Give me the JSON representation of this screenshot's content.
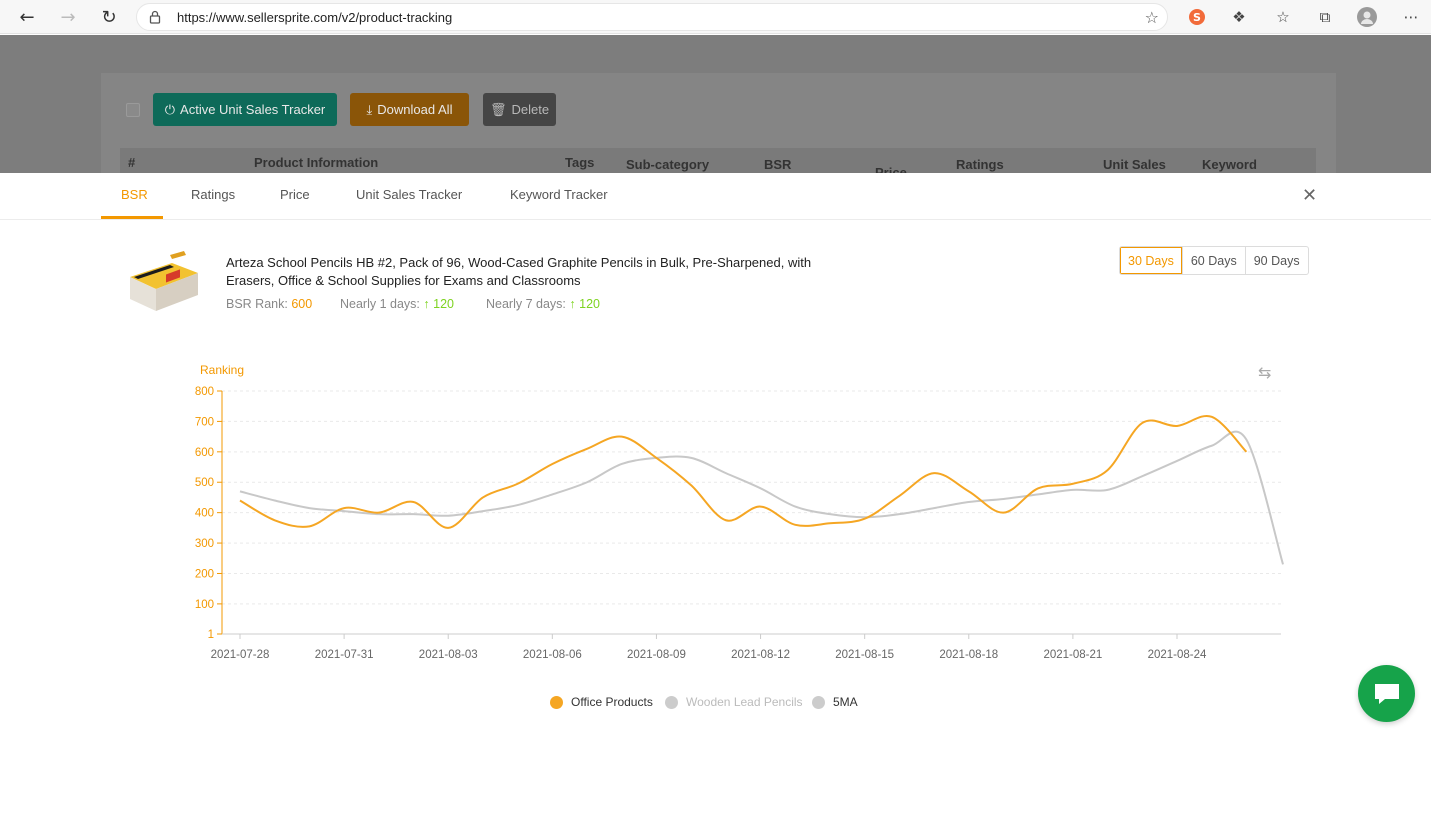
{
  "browser": {
    "url": "https://www.sellersprite.com/v2/product-tracking"
  },
  "toolbar": {
    "active_label": "Active Unit Sales Tracker",
    "download_label": "Download All",
    "delete_label": "Delete"
  },
  "table_headers": [
    "#",
    "Product Information",
    "Tags",
    "Sub-category",
    "BSR",
    "Price",
    "Ratings",
    "Unit Sales",
    "Keyword"
  ],
  "tabs": [
    "BSR",
    "Ratings",
    "Price",
    "Unit Sales Tracker",
    "Keyword Tracker"
  ],
  "active_tab": "BSR",
  "product": {
    "title": "Arteza School Pencils HB #2, Pack of 96, Wood-Cased Graphite Pencils in Bulk, Pre-Sharpened, with Erasers, Office & School Supplies for Exams and Classrooms",
    "bsr_label": "BSR Rank:",
    "bsr_value": "600",
    "n1_label": "Nearly 1 days:",
    "n1_value": "120",
    "n7_label": "Nearly 7 days:",
    "n7_value": "120"
  },
  "day_buttons": [
    "30 Days",
    "60 Days",
    "90 Days"
  ],
  "colors": {
    "accent": "#f39800",
    "series_office": "#f5a623",
    "series_wooden": "#c8c8c8",
    "positive": "#7ed321",
    "chat": "#16a34a"
  },
  "chart_data": {
    "type": "line",
    "ylabel": "Ranking",
    "ylim": [
      1,
      800
    ],
    "yticks": [
      1,
      100,
      200,
      300,
      400,
      500,
      600,
      700,
      800
    ],
    "x_tick_labels": [
      "2021-07-28",
      "2021-07-31",
      "2021-08-03",
      "2021-08-06",
      "2021-08-09",
      "2021-08-12",
      "2021-08-15",
      "2021-08-18",
      "2021-08-21",
      "2021-08-24"
    ],
    "x": [
      "2021-07-28",
      "2021-07-29",
      "2021-07-30",
      "2021-07-31",
      "2021-08-01",
      "2021-08-02",
      "2021-08-03",
      "2021-08-04",
      "2021-08-05",
      "2021-08-06",
      "2021-08-07",
      "2021-08-08",
      "2021-08-09",
      "2021-08-10",
      "2021-08-11",
      "2021-08-12",
      "2021-08-13",
      "2021-08-14",
      "2021-08-15",
      "2021-08-16",
      "2021-08-17",
      "2021-08-18",
      "2021-08-19",
      "2021-08-20",
      "2021-08-21",
      "2021-08-22",
      "2021-08-23",
      "2021-08-24",
      "2021-08-25",
      "2021-08-26",
      "2021-08-27"
    ],
    "series": [
      {
        "name": "Office Products",
        "values": [
          440,
          375,
          355,
          415,
          400,
          435,
          350,
          450,
          495,
          560,
          610,
          650,
          580,
          490,
          375,
          420,
          360,
          365,
          380,
          455,
          530,
          470,
          400,
          480,
          495,
          540,
          695,
          685,
          715,
          600,
          null
        ]
      },
      {
        "name": "Wooden Lead Pencils",
        "values": [
          470,
          440,
          415,
          405,
          395,
          395,
          390,
          405,
          425,
          460,
          500,
          560,
          580,
          580,
          530,
          480,
          420,
          395,
          385,
          395,
          415,
          435,
          445,
          460,
          475,
          475,
          520,
          570,
          620,
          640,
          230
        ]
      }
    ],
    "legend": [
      "Office Products",
      "Wooden Lead Pencils",
      "5MA"
    ],
    "grid": true,
    "legend_position": "bottom"
  }
}
